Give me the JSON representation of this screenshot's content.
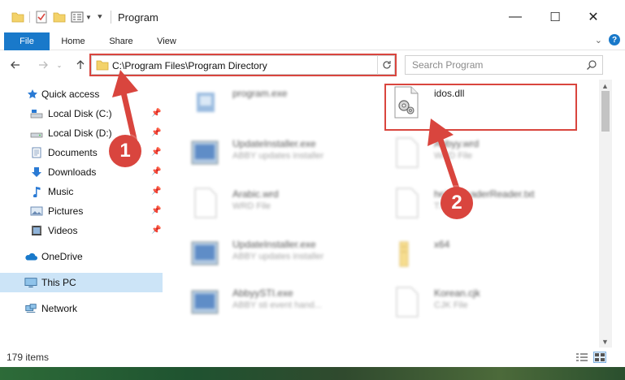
{
  "window": {
    "title": "Program",
    "minimize": "—",
    "maximize": "☐",
    "close": "✕"
  },
  "ribbon": {
    "tabs": [
      "File",
      "Home",
      "Share",
      "View"
    ],
    "help": "?"
  },
  "address": {
    "path": "C:\\Program Files\\Program Directory",
    "search_placeholder": "Search Program"
  },
  "sidebar": {
    "items": [
      {
        "label": "Quick access",
        "icon": "star-icon",
        "pinned": false
      },
      {
        "label": "Local Disk (C:)",
        "icon": "drive-icon",
        "pinned": true
      },
      {
        "label": "Local Disk (D:)",
        "icon": "drive-icon",
        "pinned": true
      },
      {
        "label": "Documents",
        "icon": "document-icon",
        "pinned": true
      },
      {
        "label": "Downloads",
        "icon": "download-arrow-icon",
        "pinned": true
      },
      {
        "label": "Music",
        "icon": "music-note-icon",
        "pinned": true
      },
      {
        "label": "Pictures",
        "icon": "picture-icon",
        "pinned": true
      },
      {
        "label": "Videos",
        "icon": "film-icon",
        "pinned": true
      },
      {
        "label": "OneDrive",
        "icon": "cloud-icon",
        "pinned": false
      },
      {
        "label": "This PC",
        "icon": "monitor-icon",
        "pinned": false
      },
      {
        "label": "Network",
        "icon": "network-icon",
        "pinned": false
      }
    ]
  },
  "files": [
    {
      "name": "program.exe",
      "desc": "",
      "icon": "exe-icon",
      "blurred": true
    },
    {
      "name": "idos.dll",
      "desc": "",
      "icon": "dll-gear-icon",
      "blurred": false
    },
    {
      "name": "UpdateInstaller.exe",
      "desc": "ABBY updates installer",
      "icon": "installer-icon",
      "blurred": true
    },
    {
      "name": "Abbyy.wrd",
      "desc": "WRD File",
      "icon": "blank-file-icon",
      "blurred": true
    },
    {
      "name": "Arabic.wrd",
      "desc": "WRD File",
      "icon": "blank-file-icon",
      "blurred": true
    },
    {
      "name": "help_ReaderReader.txt",
      "desc": "TXT File",
      "icon": "blank-file-icon",
      "blurred": true
    },
    {
      "name": "UpdateInstaller.exe",
      "desc": "ABBY updates installer",
      "icon": "installer-icon",
      "blurred": true
    },
    {
      "name": "x64",
      "desc": "",
      "icon": "folder-icon",
      "blurred": true
    },
    {
      "name": "AbbyySTI.exe",
      "desc": "ABBY sti event hand...",
      "icon": "installer-icon",
      "blurred": true
    },
    {
      "name": "Korean.cjk",
      "desc": "CJK File",
      "icon": "blank-file-icon",
      "blurred": true
    }
  ],
  "status": {
    "item_count": "179 items"
  },
  "callouts": {
    "one": "1",
    "two": "2"
  },
  "colors": {
    "accent": "#1979ca",
    "highlight": "#d9453e",
    "selected_row": "#cce4f7"
  }
}
